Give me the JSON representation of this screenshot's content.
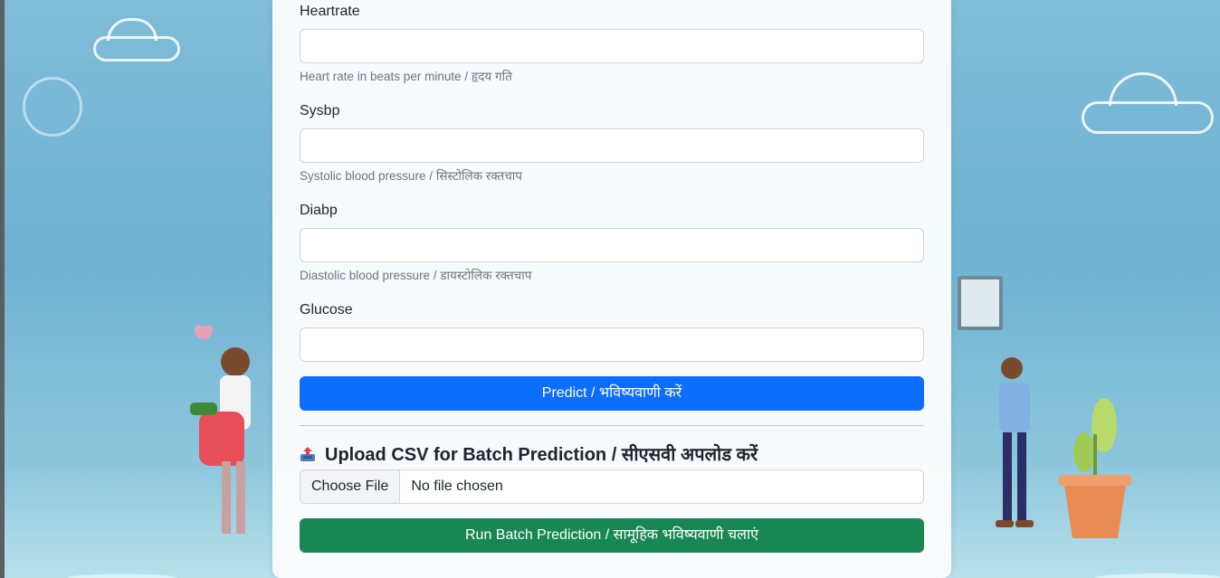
{
  "fields": [
    {
      "label": "Heartrate",
      "value": "",
      "help": "Heart rate in beats per minute / हृदय गति"
    },
    {
      "label": "Sysbp",
      "value": "",
      "help": "Systolic blood pressure / सिस्टोलिक रक्तचाप"
    },
    {
      "label": "Diabp",
      "value": "",
      "help": "Diastolic blood pressure / डायस्टोलिक रक्तचाप"
    },
    {
      "label": "Glucose",
      "value": "",
      "help": ""
    }
  ],
  "predict_button": "Predict / भविष्यवाणी करें",
  "upload": {
    "title": "Upload CSV for Batch Prediction / सीएसवी अपलोड करें",
    "icon": "upload-tray-icon",
    "choose_file": "Choose File",
    "file_status": "No file chosen"
  },
  "batch_button": "Run Batch Prediction / सामूहिक भविष्यवाणी चलाएं",
  "colors": {
    "primary": "#0d6efd",
    "success": "#198754"
  }
}
